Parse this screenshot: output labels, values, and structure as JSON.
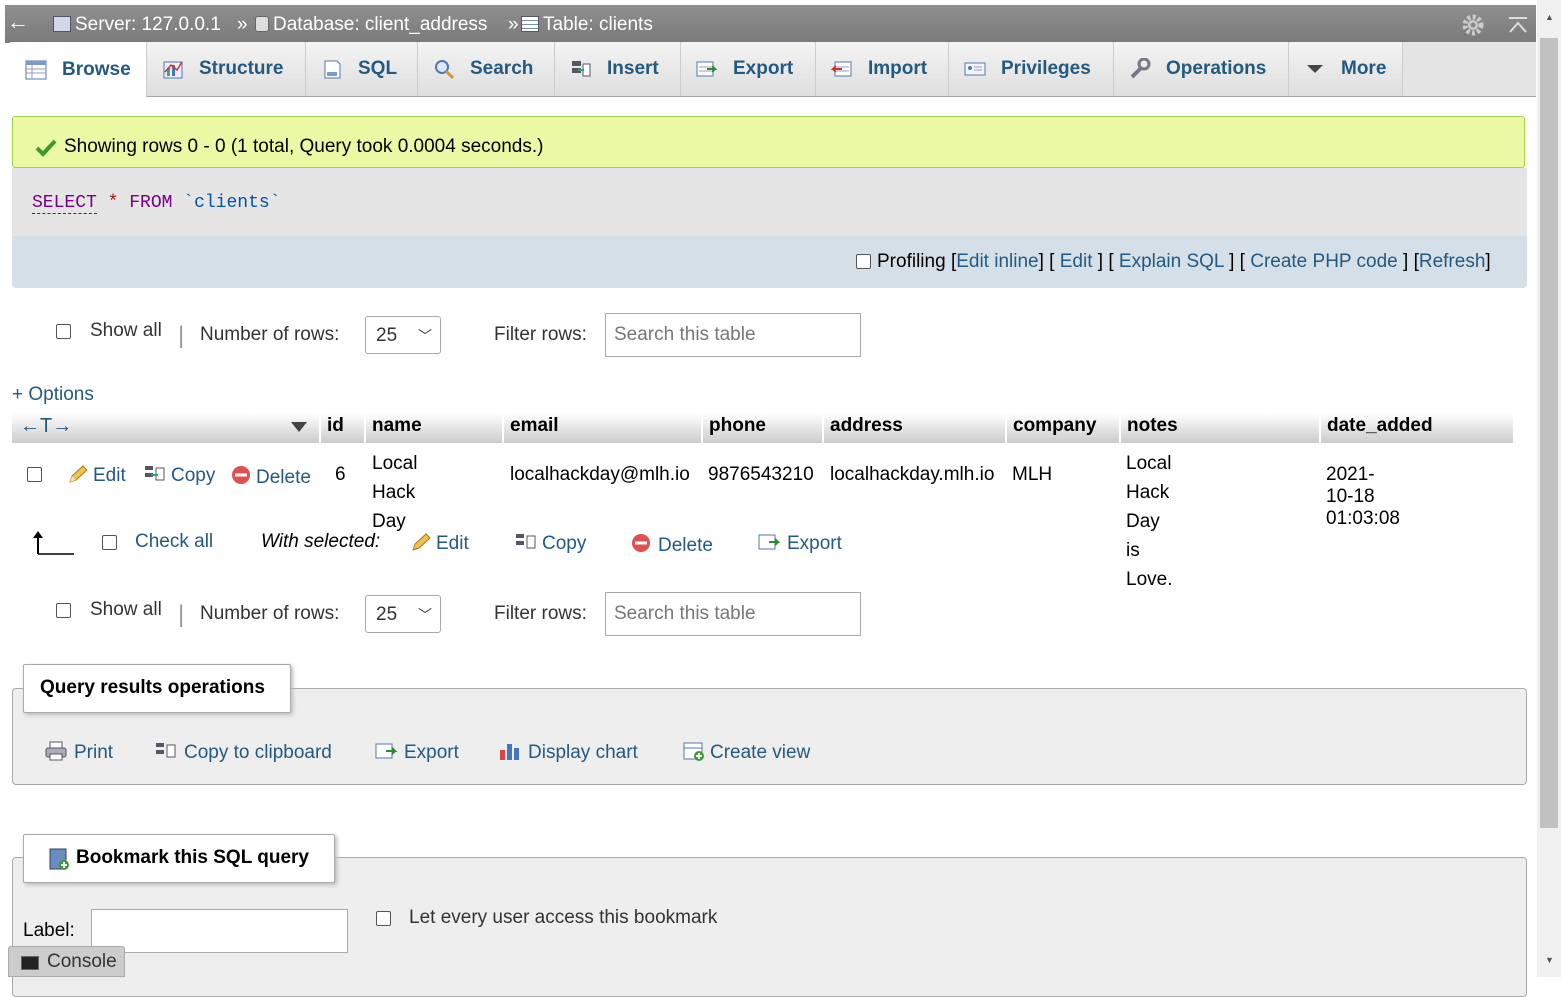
{
  "breadcrumb": {
    "back": "←",
    "server": "Server: 127.0.0.1",
    "sep1": "»",
    "database": "Database: client_address",
    "sep2": "»",
    "table": "Table: clients"
  },
  "tabs": [
    {
      "label": "Browse",
      "icon": "browse-icon"
    },
    {
      "label": "Structure",
      "icon": "structure-icon"
    },
    {
      "label": "SQL",
      "icon": "sql-icon"
    },
    {
      "label": "Search",
      "icon": "search-icon"
    },
    {
      "label": "Insert",
      "icon": "insert-icon"
    },
    {
      "label": "Export",
      "icon": "export-icon"
    },
    {
      "label": "Import",
      "icon": "import-icon"
    },
    {
      "label": "Privileges",
      "icon": "privileges-icon"
    },
    {
      "label": "Operations",
      "icon": "operations-icon"
    },
    {
      "label": "More",
      "icon": "triangle-down-icon"
    }
  ],
  "success_message": "Showing rows 0 - 0 (1 total, Query took 0.0004 seconds.)",
  "sql": {
    "select": "SELECT",
    "star": "*",
    "from": "FROM",
    "table": "`clients`"
  },
  "tools": {
    "profiling": "Profiling",
    "edit_inline": "Edit inline",
    "edit": "Edit",
    "explain": "Explain SQL",
    "create_php": "Create PHP code",
    "refresh": "Refresh",
    "ob": "[",
    "cb": "]"
  },
  "nav": {
    "show_all": "Show all",
    "rows_label": "Number of rows:",
    "rows_value": "25",
    "filter_label": "Filter rows:",
    "filter_placeholder": "Search this table",
    "sep": "|"
  },
  "options_link": "+ Options",
  "columns": [
    "id",
    "name",
    "email",
    "phone",
    "address",
    "company",
    "notes",
    "date_added"
  ],
  "row_actions": {
    "edit": "Edit",
    "copy": "Copy",
    "delete": "Delete"
  },
  "rows": [
    {
      "id": "6",
      "name_1": "Local Hack",
      "name_2": "Day",
      "email": "localhackday@mlh.io",
      "phone": "9876543210",
      "address": "localhackday.mlh.io",
      "company": "MLH",
      "notes_1": "Local Hack Day is",
      "notes_2": "Love.",
      "date_added": "2021-10-18 01:03:08"
    }
  ],
  "bulk": {
    "check_all": "Check all",
    "with_selected": "With selected:",
    "edit": "Edit",
    "copy": "Copy",
    "delete": "Delete",
    "export": "Export"
  },
  "query_ops": {
    "legend": "Query results operations",
    "print": "Print",
    "copy_clipboard": "Copy to clipboard",
    "export": "Export",
    "display_chart": "Display chart",
    "create_view": "Create view"
  },
  "bookmark": {
    "legend": "Bookmark this SQL query",
    "label": "Label:",
    "every_user": "Let every user access this bookmark"
  },
  "console": "Console",
  "colors": {
    "link": "#235a81",
    "success_bg": "#ebf8a4",
    "topbar": "#888888"
  }
}
